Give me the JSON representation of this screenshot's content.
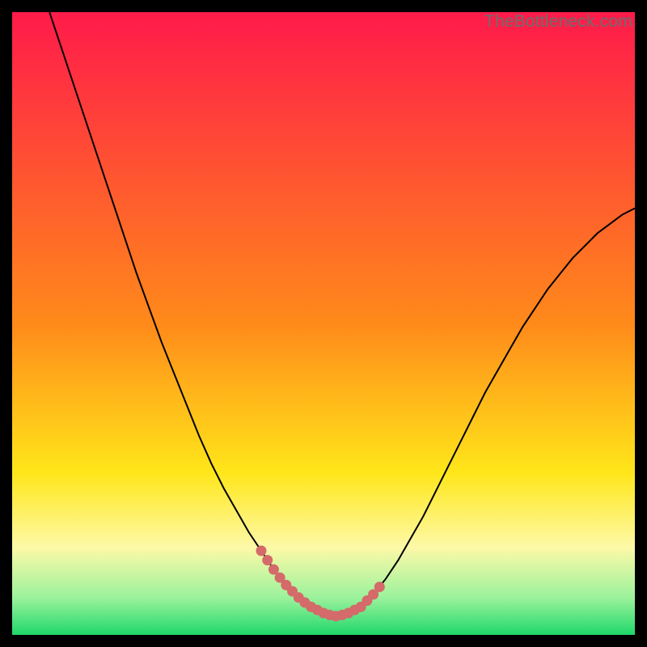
{
  "watermark": "TheBottleneck.com",
  "colors": {
    "frame_background": "#000000",
    "gradient_top": "#ff1a4a",
    "gradient_mid_orange": "#ff8a1a",
    "gradient_yellow": "#ffe61a",
    "gradient_pale_yellow": "#fdf9a8",
    "gradient_light_green": "#9cf29c",
    "gradient_green": "#1fd86a",
    "curve_stroke": "#000000",
    "marker_stroke": "#d46a6a",
    "marker_fill": "#d46a6a"
  },
  "chart_data": {
    "type": "line",
    "title": "",
    "xlabel": "",
    "ylabel": "",
    "xlim": [
      0,
      100
    ],
    "ylim": [
      0,
      100
    ],
    "series": [
      {
        "name": "bottleneck-curve",
        "x": [
          6,
          8,
          10,
          12,
          14,
          16,
          18,
          20,
          22,
          24,
          26,
          28,
          30,
          32,
          34,
          36,
          38,
          40,
          42,
          44,
          46,
          48,
          50,
          52,
          54,
          56,
          58,
          60,
          62,
          64,
          66,
          68,
          70,
          72,
          74,
          76,
          78,
          80,
          82,
          84,
          86,
          88,
          90,
          92,
          94,
          96,
          98,
          100
        ],
        "y": [
          100,
          94,
          88,
          82,
          76,
          70,
          64,
          58,
          52.5,
          47,
          42,
          37,
          32,
          27.5,
          23.5,
          20,
          16.5,
          13.5,
          10.5,
          8,
          6,
          4.5,
          3.5,
          3,
          3.5,
          4.5,
          6.5,
          9,
          12,
          15.5,
          19,
          23,
          27,
          31,
          35,
          39,
          42.5,
          46,
          49.5,
          52.5,
          55.5,
          58,
          60.5,
          62.5,
          64.5,
          66,
          67.5,
          68.5
        ]
      }
    ],
    "markers": {
      "name": "highlighted-segment",
      "x": [
        40,
        41,
        42,
        43,
        44,
        45,
        46,
        47,
        48,
        49,
        50,
        51,
        52,
        53,
        54,
        55,
        56,
        57,
        58,
        59
      ],
      "y": [
        13.5,
        12,
        10.5,
        9.2,
        8,
        7,
        6,
        5.2,
        4.5,
        4,
        3.5,
        3.2,
        3,
        3.2,
        3.5,
        4,
        4.5,
        5.5,
        6.5,
        7.7
      ]
    },
    "gradient_bands": [
      {
        "y": 100,
        "color": "#ff1a4a"
      },
      {
        "y": 50,
        "color": "#ff8a1a"
      },
      {
        "y": 25,
        "color": "#ffe61a"
      },
      {
        "y": 12,
        "color": "#fdf9a8"
      },
      {
        "y": 5,
        "color": "#9cf29c"
      },
      {
        "y": 0,
        "color": "#1fd86a"
      }
    ]
  }
}
